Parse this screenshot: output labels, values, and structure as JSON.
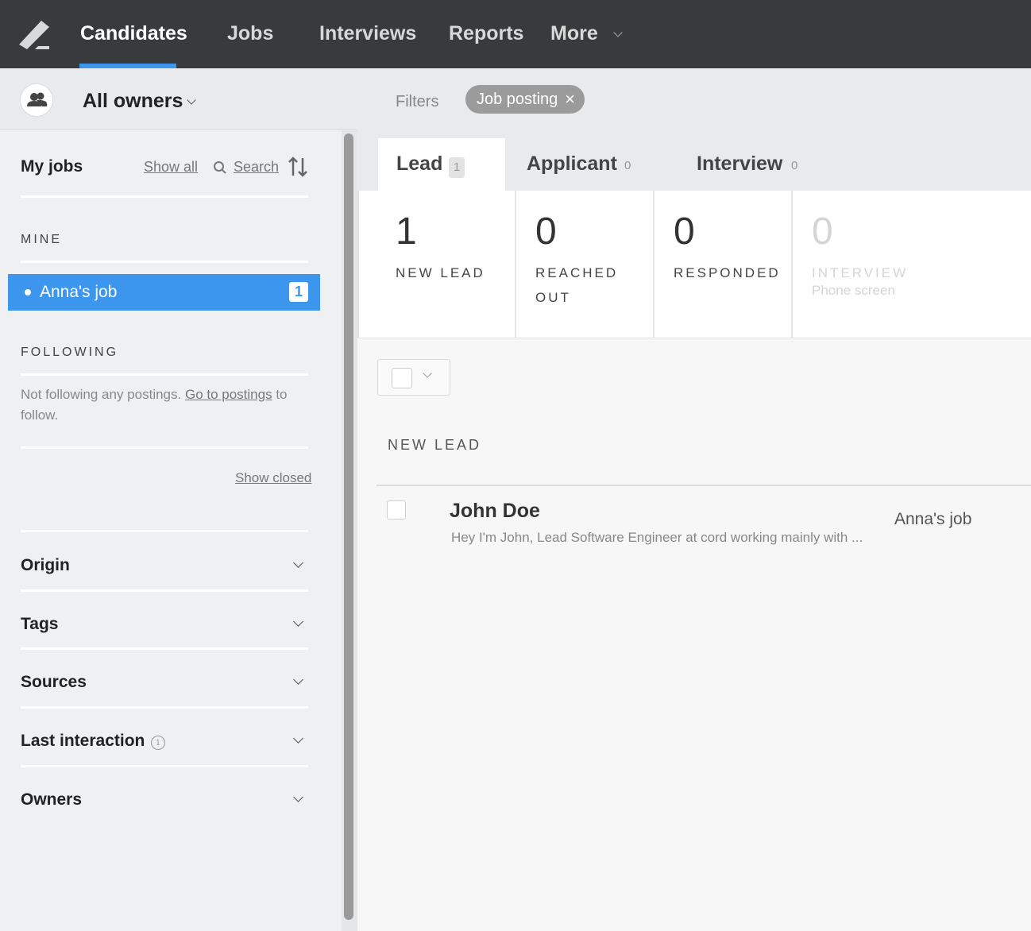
{
  "nav": {
    "items": [
      {
        "label": "Candidates",
        "active": true
      },
      {
        "label": "Jobs"
      },
      {
        "label": "Interviews"
      },
      {
        "label": "Reports"
      },
      {
        "label": "More"
      }
    ],
    "accent": "#3d96ee"
  },
  "owner": {
    "label": "All owners",
    "icon": "people-icon"
  },
  "sidebar": {
    "my_jobs": "My jobs",
    "show_all": "Show all",
    "search": "Search",
    "mine_title": "MINE",
    "job": {
      "label": "Anna's job",
      "count": "1"
    },
    "following_title": "FOLLOWING",
    "following_text": "Not following any postings.",
    "following_link": "Go to postings",
    "following_tail": "to follow.",
    "show_closed": "Show closed",
    "facets": [
      {
        "label": "Origin"
      },
      {
        "label": "Tags"
      },
      {
        "label": "Sources"
      },
      {
        "label": "Last interaction",
        "info": "i"
      },
      {
        "label": "Owners"
      }
    ]
  },
  "filters": {
    "label": "Filters",
    "chip": "Job posting",
    "chip_close": "×"
  },
  "tabs": [
    {
      "label": "Lead",
      "count": "1"
    },
    {
      "label": "Applicant",
      "count": "0"
    },
    {
      "label": "Interview",
      "count": "0"
    }
  ],
  "stages": [
    {
      "count": "1",
      "label": "NEW LEAD"
    },
    {
      "count": "0",
      "label": "REACHED OUT"
    },
    {
      "count": "0",
      "label": "RESPONDED"
    },
    {
      "count": "0",
      "label": "INTERVIEW",
      "sub": "Phone screen"
    }
  ],
  "list": {
    "header": "NEW LEAD",
    "candidates": [
      {
        "name": "John Doe",
        "snippet": "Hey I'm John, Lead Software Engineer at cord working mainly with ...",
        "job": "Anna's job"
      }
    ]
  }
}
